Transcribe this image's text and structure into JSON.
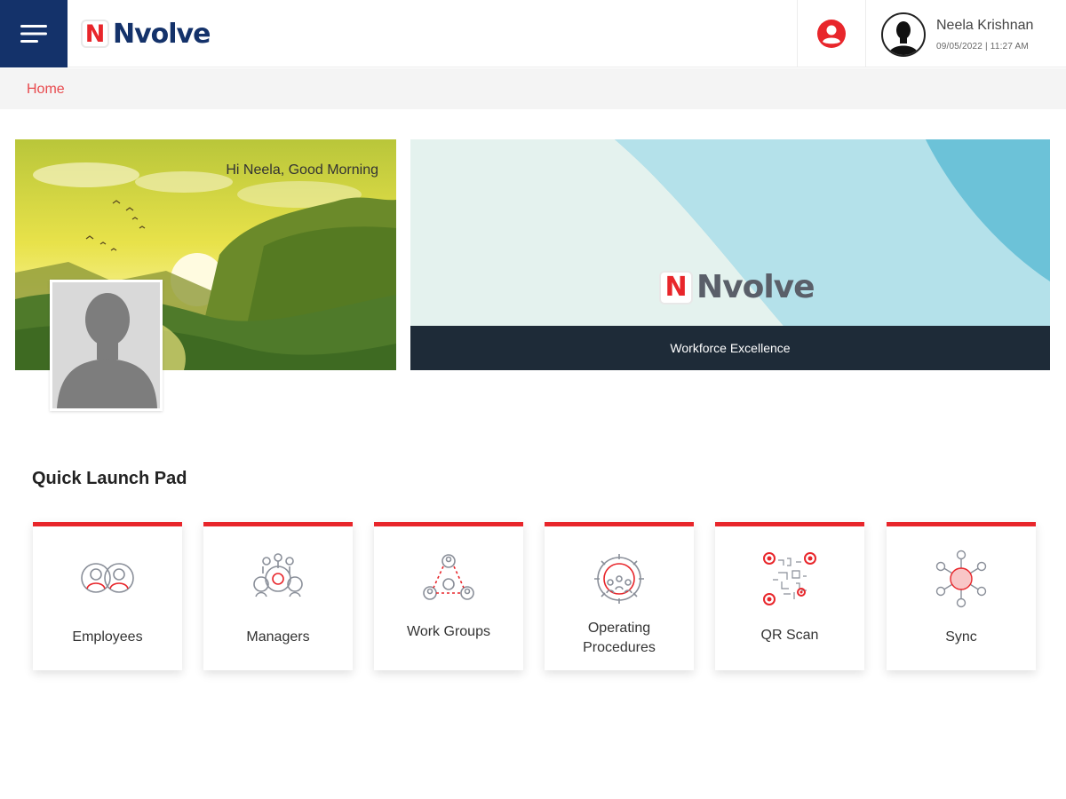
{
  "header": {
    "logo_mark": "N",
    "logo_text": "Nvolve",
    "user_name": "Neela Krishnan",
    "user_timestamp": "09/05/2022 | 11:27 AM",
    "brand_colors": {
      "navy": "#14326a",
      "red": "#e8262b"
    },
    "icons": {
      "menu": "hamburger-menu-icon",
      "profile": "account-circle-icon",
      "avatar": "user-silhouette-icon"
    }
  },
  "breadcrumb": {
    "home": "Home"
  },
  "greeting": {
    "text": "Hi Neela, Good Morning"
  },
  "brand_banner": {
    "logo_mark": "N",
    "logo_text": "Nvolve",
    "tagline": "Workforce Excellence"
  },
  "quick_launch": {
    "title": "Quick Launch Pad",
    "tiles": [
      {
        "label": "Employees",
        "icon": "employees-icon"
      },
      {
        "label": "Managers",
        "icon": "managers-icon"
      },
      {
        "label": "Work Groups",
        "icon": "work-groups-icon"
      },
      {
        "label": "Operating Procedures",
        "line1": "Operating",
        "line2": "Procedures",
        "icon": "operating-procedures-icon"
      },
      {
        "label": "QR Scan",
        "icon": "qr-scan-icon"
      },
      {
        "label": "Sync",
        "icon": "sync-icon"
      }
    ]
  }
}
